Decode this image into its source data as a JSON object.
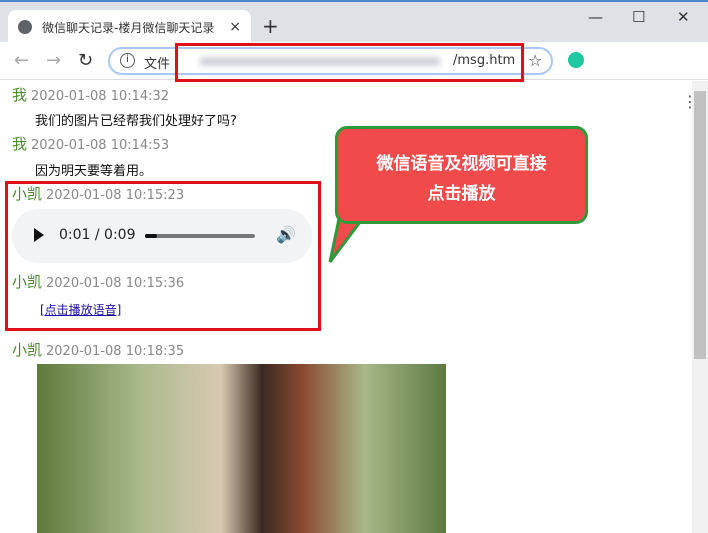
{
  "browser": {
    "tab_title": "微信聊天记录-楼月微信聊天记录",
    "url_prefix": "文件",
    "url_path": "/msg.htm",
    "new_tab": "+",
    "close_tab": "×"
  },
  "messages": [
    {
      "sender": "我",
      "time": "2020-01-08 10:14:32",
      "text": "我们的图片已经帮我们处理好了吗?"
    },
    {
      "sender": "我",
      "time": "2020-01-08 10:14:53",
      "text": "因为明天要等着用。"
    },
    {
      "sender": "小凯",
      "time": "2020-01-08 10:15:23",
      "audio": {
        "current": "0:01 / 0:09",
        "progress": 0.11
      }
    },
    {
      "sender": "小凯",
      "time": "2020-01-08 10:15:36",
      "link": "[点击播放语音]"
    },
    {
      "sender": "小凯",
      "time": "2020-01-08 10:18:35"
    }
  ],
  "callout": {
    "line1": "微信语音及视频可直接",
    "line2": "点击播放"
  }
}
